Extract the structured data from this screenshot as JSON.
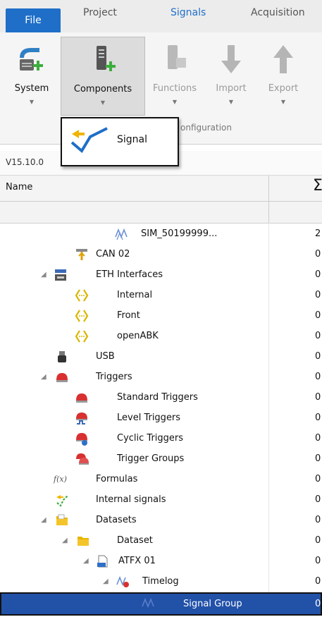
{
  "menu": {
    "file": "File",
    "project": "Project",
    "signals": "Signals",
    "acquisition": "Acquisition"
  },
  "ribbon": {
    "system": "System",
    "components": "Components",
    "functions": "Functions",
    "import": "Import",
    "export": "Export",
    "group_label": "Configuration",
    "group_label_visible": "onfiguration"
  },
  "dropdown": {
    "signal": "Signal"
  },
  "version": "V15.10.0",
  "grid": {
    "name_header": "Name",
    "sum_header": "Σ"
  },
  "tree": [
    {
      "label": "SIM_50199999...",
      "value": "2",
      "icon": "signal-wave-icon"
    },
    {
      "label": "CAN 02",
      "value": "0",
      "icon": "can-bus-icon"
    },
    {
      "label": "ETH Interfaces",
      "value": "0",
      "icon": "ethernet-icon"
    },
    {
      "label": "Internal",
      "value": "0",
      "icon": "interface-bracket-icon"
    },
    {
      "label": "Front",
      "value": "0",
      "icon": "interface-bracket-icon"
    },
    {
      "label": "openABK",
      "value": "0",
      "icon": "interface-bracket-icon"
    },
    {
      "label": "USB",
      "value": "0",
      "icon": "usb-icon"
    },
    {
      "label": "Triggers",
      "value": "0",
      "icon": "trigger-icon"
    },
    {
      "label": "Standard Triggers",
      "value": "0",
      "icon": "trigger-icon"
    },
    {
      "label": "Level Triggers",
      "value": "0",
      "icon": "level-trigger-icon"
    },
    {
      "label": "Cyclic Triggers",
      "value": "0",
      "icon": "cyclic-trigger-icon"
    },
    {
      "label": "Trigger Groups",
      "value": "0",
      "icon": "trigger-group-icon"
    },
    {
      "label": "Formulas",
      "value": "0",
      "icon": "formula-icon"
    },
    {
      "label": "Internal signals",
      "value": "0",
      "icon": "internal-signal-icon"
    },
    {
      "label": "Datasets",
      "value": "0",
      "icon": "folder-icon"
    },
    {
      "label": "Dataset",
      "value": "0",
      "icon": "folder-icon"
    },
    {
      "label": "ATFX 01",
      "value": "0",
      "icon": "atfx-file-icon"
    },
    {
      "label": "Timelog",
      "value": "0",
      "icon": "timelog-icon"
    },
    {
      "label": "Signal Group",
      "value": "0",
      "icon": "signal-group-icon"
    }
  ]
}
